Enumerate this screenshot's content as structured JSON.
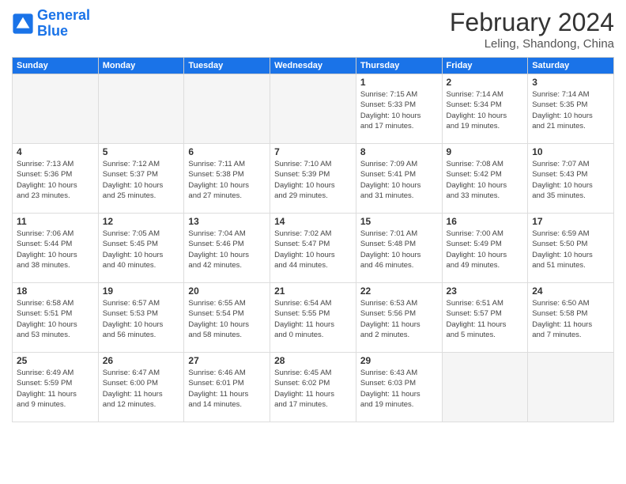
{
  "header": {
    "logo_general": "General",
    "logo_blue": "Blue",
    "month": "February 2024",
    "location": "Leling, Shandong, China"
  },
  "days_of_week": [
    "Sunday",
    "Monday",
    "Tuesday",
    "Wednesday",
    "Thursday",
    "Friday",
    "Saturday"
  ],
  "weeks": [
    [
      {
        "day": "",
        "info": ""
      },
      {
        "day": "",
        "info": ""
      },
      {
        "day": "",
        "info": ""
      },
      {
        "day": "",
        "info": ""
      },
      {
        "day": "1",
        "info": "Sunrise: 7:15 AM\nSunset: 5:33 PM\nDaylight: 10 hours\nand 17 minutes."
      },
      {
        "day": "2",
        "info": "Sunrise: 7:14 AM\nSunset: 5:34 PM\nDaylight: 10 hours\nand 19 minutes."
      },
      {
        "day": "3",
        "info": "Sunrise: 7:14 AM\nSunset: 5:35 PM\nDaylight: 10 hours\nand 21 minutes."
      }
    ],
    [
      {
        "day": "4",
        "info": "Sunrise: 7:13 AM\nSunset: 5:36 PM\nDaylight: 10 hours\nand 23 minutes."
      },
      {
        "day": "5",
        "info": "Sunrise: 7:12 AM\nSunset: 5:37 PM\nDaylight: 10 hours\nand 25 minutes."
      },
      {
        "day": "6",
        "info": "Sunrise: 7:11 AM\nSunset: 5:38 PM\nDaylight: 10 hours\nand 27 minutes."
      },
      {
        "day": "7",
        "info": "Sunrise: 7:10 AM\nSunset: 5:39 PM\nDaylight: 10 hours\nand 29 minutes."
      },
      {
        "day": "8",
        "info": "Sunrise: 7:09 AM\nSunset: 5:41 PM\nDaylight: 10 hours\nand 31 minutes."
      },
      {
        "day": "9",
        "info": "Sunrise: 7:08 AM\nSunset: 5:42 PM\nDaylight: 10 hours\nand 33 minutes."
      },
      {
        "day": "10",
        "info": "Sunrise: 7:07 AM\nSunset: 5:43 PM\nDaylight: 10 hours\nand 35 minutes."
      }
    ],
    [
      {
        "day": "11",
        "info": "Sunrise: 7:06 AM\nSunset: 5:44 PM\nDaylight: 10 hours\nand 38 minutes."
      },
      {
        "day": "12",
        "info": "Sunrise: 7:05 AM\nSunset: 5:45 PM\nDaylight: 10 hours\nand 40 minutes."
      },
      {
        "day": "13",
        "info": "Sunrise: 7:04 AM\nSunset: 5:46 PM\nDaylight: 10 hours\nand 42 minutes."
      },
      {
        "day": "14",
        "info": "Sunrise: 7:02 AM\nSunset: 5:47 PM\nDaylight: 10 hours\nand 44 minutes."
      },
      {
        "day": "15",
        "info": "Sunrise: 7:01 AM\nSunset: 5:48 PM\nDaylight: 10 hours\nand 46 minutes."
      },
      {
        "day": "16",
        "info": "Sunrise: 7:00 AM\nSunset: 5:49 PM\nDaylight: 10 hours\nand 49 minutes."
      },
      {
        "day": "17",
        "info": "Sunrise: 6:59 AM\nSunset: 5:50 PM\nDaylight: 10 hours\nand 51 minutes."
      }
    ],
    [
      {
        "day": "18",
        "info": "Sunrise: 6:58 AM\nSunset: 5:51 PM\nDaylight: 10 hours\nand 53 minutes."
      },
      {
        "day": "19",
        "info": "Sunrise: 6:57 AM\nSunset: 5:53 PM\nDaylight: 10 hours\nand 56 minutes."
      },
      {
        "day": "20",
        "info": "Sunrise: 6:55 AM\nSunset: 5:54 PM\nDaylight: 10 hours\nand 58 minutes."
      },
      {
        "day": "21",
        "info": "Sunrise: 6:54 AM\nSunset: 5:55 PM\nDaylight: 11 hours\nand 0 minutes."
      },
      {
        "day": "22",
        "info": "Sunrise: 6:53 AM\nSunset: 5:56 PM\nDaylight: 11 hours\nand 2 minutes."
      },
      {
        "day": "23",
        "info": "Sunrise: 6:51 AM\nSunset: 5:57 PM\nDaylight: 11 hours\nand 5 minutes."
      },
      {
        "day": "24",
        "info": "Sunrise: 6:50 AM\nSunset: 5:58 PM\nDaylight: 11 hours\nand 7 minutes."
      }
    ],
    [
      {
        "day": "25",
        "info": "Sunrise: 6:49 AM\nSunset: 5:59 PM\nDaylight: 11 hours\nand 9 minutes."
      },
      {
        "day": "26",
        "info": "Sunrise: 6:47 AM\nSunset: 6:00 PM\nDaylight: 11 hours\nand 12 minutes."
      },
      {
        "day": "27",
        "info": "Sunrise: 6:46 AM\nSunset: 6:01 PM\nDaylight: 11 hours\nand 14 minutes."
      },
      {
        "day": "28",
        "info": "Sunrise: 6:45 AM\nSunset: 6:02 PM\nDaylight: 11 hours\nand 17 minutes."
      },
      {
        "day": "29",
        "info": "Sunrise: 6:43 AM\nSunset: 6:03 PM\nDaylight: 11 hours\nand 19 minutes."
      },
      {
        "day": "",
        "info": ""
      },
      {
        "day": "",
        "info": ""
      }
    ]
  ]
}
